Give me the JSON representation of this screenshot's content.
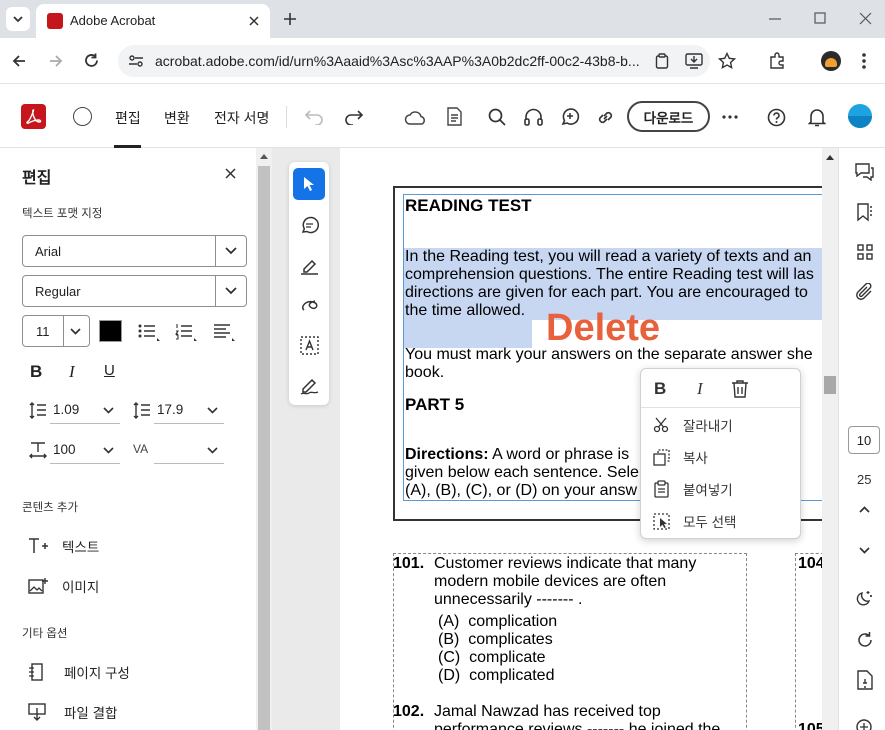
{
  "browser": {
    "tab_title": "Adobe Acrobat",
    "url": "acrobat.adobe.com/id/urn%3Aaaid%3Asc%3AAP%3A0b2dc2ff-00c2-43b8-b..."
  },
  "toolbar": {
    "menu": [
      "편집",
      "변환",
      "전자 서명"
    ],
    "download_label": "다운로드"
  },
  "left_panel": {
    "title": "편집",
    "text_format_heading": "텍스트 포맷 지정",
    "font_family": "Arial",
    "font_style": "Regular",
    "font_size": "11",
    "line_spacing": "1.09",
    "para_spacing": "17.9",
    "scale": "100",
    "va_label": "VA",
    "add_content_heading": "콘텐츠 추가",
    "add_text": "텍스트",
    "add_image": "이미지",
    "other_options_heading": "기타 옵션",
    "page_organize": "페이지 구성",
    "file_combine": "파일 결합"
  },
  "document": {
    "heading": "READING TEST",
    "para1": [
      "In the Reading test, you will read a variety of texts and an",
      "comprehension questions. The entire Reading test will las",
      "directions are given for each part. You are encouraged to",
      "the time allowed."
    ],
    "para2": [
      "You must mark your answers on the separate answer she",
      "book."
    ],
    "part": "PART 5",
    "directions_bold": "Directions:",
    "directions": [
      " A word or phrase is",
      "given below each sentence. Sele",
      "(A), (B), (C), or (D) on your answ"
    ],
    "delete_watermark": "Delete",
    "q101": {
      "num": "101.",
      "lines": [
        "Customer reviews indicate that many",
        "modern mobile devices are often",
        "unnecessarily ------- ."
      ],
      "options": [
        "(A)  complication",
        "(B)  complicates",
        "(C)  complicate",
        "(D)  complicated"
      ]
    },
    "q102": {
      "num": "102.",
      "lines": [
        "Jamal Nawzad has received top",
        "performance reviews ------- he joined the"
      ]
    },
    "q104_num": "104",
    "q105_num": "105"
  },
  "context_menu": {
    "cut": "잘라내기",
    "copy": "복사",
    "paste": "붙여넣기",
    "select_all": "모두 선택"
  },
  "right_rail": {
    "page_number": "10",
    "total_pages": "25"
  },
  "colors": {
    "acrobat_red": "#c4161c",
    "tool_active": "#1473e6",
    "delete_text": "#e8613c",
    "selection": "#c7d7f1"
  }
}
